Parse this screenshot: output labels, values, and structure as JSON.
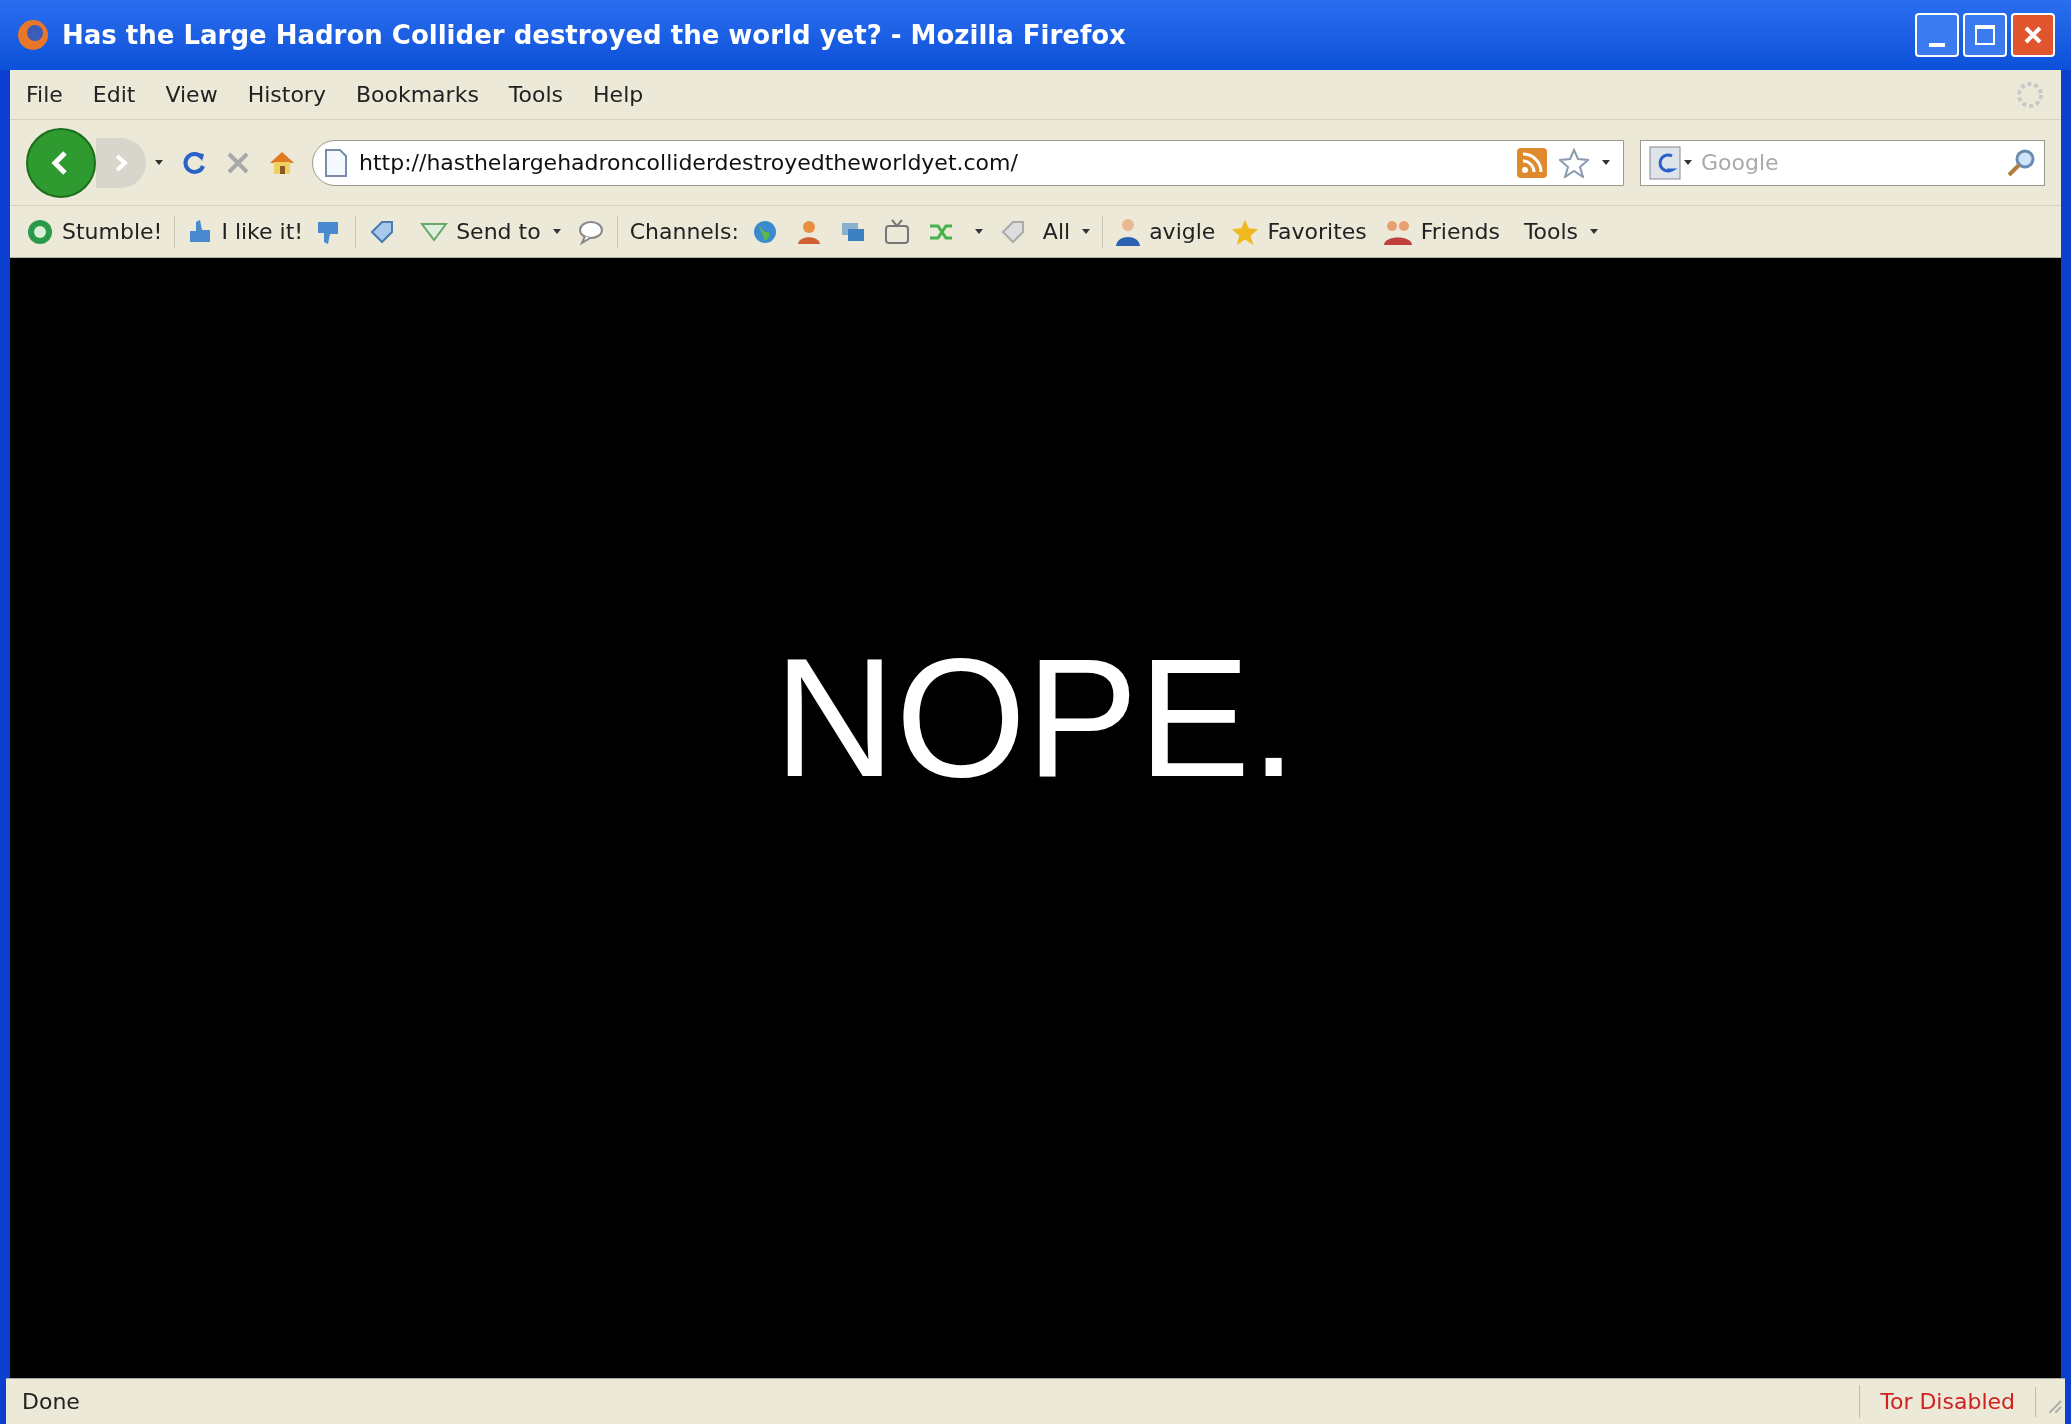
{
  "window": {
    "title": "Has the Large Hadron Collider destroyed the world yet? - Mozilla Firefox"
  },
  "menu": [
    "File",
    "Edit",
    "View",
    "History",
    "Bookmarks",
    "Tools",
    "Help"
  ],
  "navigation": {
    "url": "http://hasthelargehadroncolliderdestroyedtheworldyet.com/",
    "search": {
      "placeholder": "Google"
    }
  },
  "stumble_toolbar": {
    "stumble": {
      "label": "Stumble!"
    },
    "like": {
      "label": "I like it!"
    },
    "send_to": {
      "label": "Send to",
      "dropdown": true
    },
    "channels": {
      "label": "Channels:"
    },
    "all": {
      "label": "All",
      "dropdown": true
    },
    "user": {
      "label": "avigle"
    },
    "favorites": {
      "label": "Favorites"
    },
    "friends": {
      "label": "Friends"
    },
    "tools": {
      "label": "Tools",
      "dropdown": true
    }
  },
  "page": {
    "text": "NOPE."
  },
  "status_bar": {
    "status": "Done",
    "tor": "Tor Disabled"
  }
}
